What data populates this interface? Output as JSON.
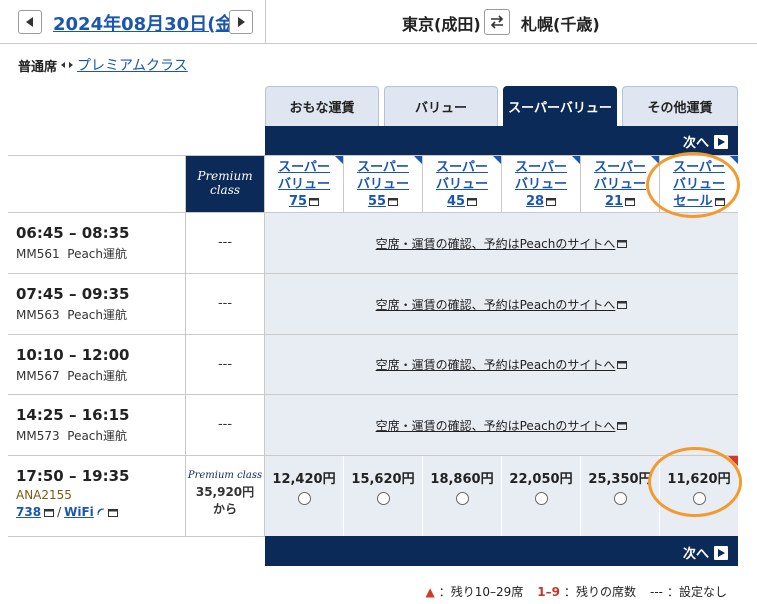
{
  "header": {
    "date": "2024年08月30日(金)",
    "origin": "東京(成田)",
    "destination": "札幌(千歳)"
  },
  "seat_class": {
    "current": "普通席",
    "alternate": "プレミアムクラス"
  },
  "tabs": [
    {
      "label": "おもな運賃",
      "active": false
    },
    {
      "label": "バリュー",
      "active": false
    },
    {
      "label": "スーパーバリュー",
      "active": true
    },
    {
      "label": "その他運賃",
      "active": false
    }
  ],
  "next_label": "次へ",
  "premium_header": [
    "Premium",
    "class"
  ],
  "fare_columns": [
    {
      "line1": "スーパー",
      "line2": "バリュー",
      "line3": "75"
    },
    {
      "line1": "スーパー",
      "line2": "バリュー",
      "line3": "55"
    },
    {
      "line1": "スーパー",
      "line2": "バリュー",
      "line3": "45"
    },
    {
      "line1": "スーパー",
      "line2": "バリュー",
      "line3": "28"
    },
    {
      "line1": "スーパー",
      "line2": "バリュー",
      "line3": "21"
    },
    {
      "line1": "スーパー",
      "line2": "バリュー",
      "line3": "セール"
    }
  ],
  "flights": [
    {
      "time": "06:45 – 08:35",
      "number": "MM561",
      "operator": "Peach運航",
      "premium": "---",
      "peach_link": "空席・運賃の確認、予約はPeachのサイトへ"
    },
    {
      "time": "07:45 – 09:35",
      "number": "MM563",
      "operator": "Peach運航",
      "premium": "---",
      "peach_link": "空席・運賃の確認、予約はPeachのサイトへ"
    },
    {
      "time": "10:10 – 12:00",
      "number": "MM567",
      "operator": "Peach運航",
      "premium": "---",
      "peach_link": "空席・運賃の確認、予約はPeachのサイトへ"
    },
    {
      "time": "14:25 – 16:15",
      "number": "MM573",
      "operator": "Peach運航",
      "premium": "---",
      "peach_link": "空席・運賃の確認、予約はPeachのサイトへ"
    }
  ],
  "ana_flight": {
    "time": "17:50 – 19:35",
    "number": "ANA2155",
    "aircraft": "738",
    "wifi": "WiFi",
    "premium_label": "Premium class",
    "premium_price": "35,920円",
    "premium_from": "から",
    "fares": [
      "12,420円",
      "15,620円",
      "18,860円",
      "22,050円",
      "25,350円",
      "11,620円"
    ]
  },
  "legend": {
    "triangle": "▲",
    "triangle_text": "：残り10–29席",
    "range": "1–9",
    "range_text": "：残りの席数",
    "dash": "---",
    "dash_text": "：設定なし"
  },
  "colors": {
    "navy": "#0b2a57",
    "link": "#1a56b0",
    "highlight_ring": "#f39a2f",
    "cell_bg": "#e8ecf3"
  }
}
